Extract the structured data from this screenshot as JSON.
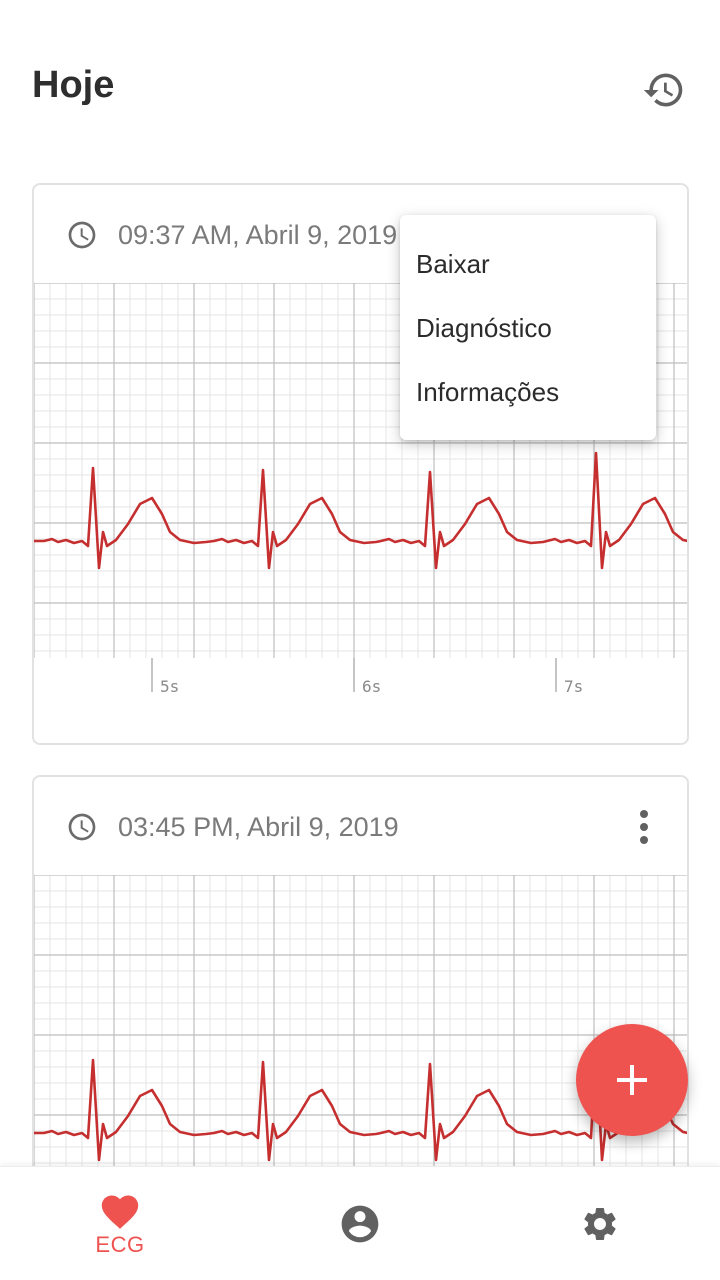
{
  "header": {
    "title": "Hoje",
    "history_icon": "history-icon"
  },
  "records": [
    {
      "time": "09:37 AM, Abril 9, 2019",
      "scale_labels": [
        "5s",
        "6s",
        "7s"
      ]
    },
    {
      "time": "03:45 PM, Abril 9, 2019"
    }
  ],
  "menu": {
    "items": [
      "Baixar",
      "Diagnóstico",
      "Informações"
    ]
  },
  "fab": {
    "icon": "plus-icon"
  },
  "bottom_nav": {
    "items": [
      {
        "icon": "heart-icon",
        "label": "ECG",
        "active": true
      },
      {
        "icon": "account-circle-icon",
        "label": ""
      },
      {
        "icon": "settings-gear-icon",
        "label": ""
      }
    ]
  },
  "colors": {
    "accent": "#ef5350",
    "ecg_trace": "#c62f2f",
    "grid_minor": "#e6e6e6",
    "grid_major": "#bdbdbd",
    "icon_gray": "#616161"
  }
}
